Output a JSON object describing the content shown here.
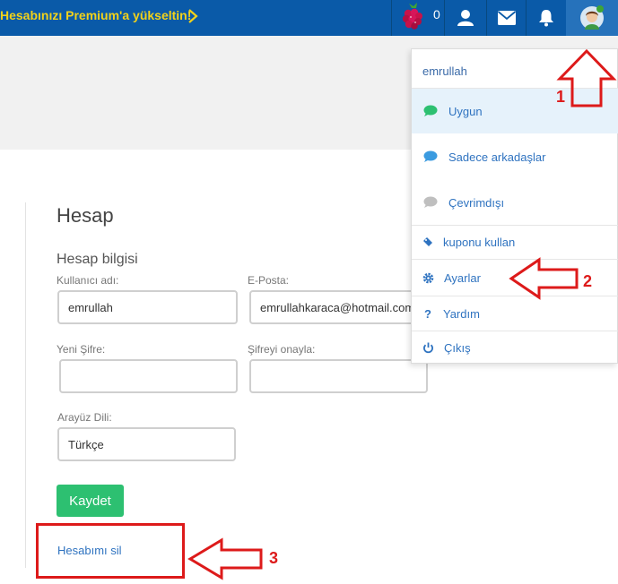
{
  "topbar": {
    "premium_label": "Hesabınızı Premium'a yükseltin!",
    "credits": "0",
    "icons": [
      "raspberry-icon",
      "user-icon",
      "mail-icon",
      "bell-icon",
      "avatar-icon"
    ],
    "background": "#0a5aa8",
    "premium_color": "#f2d21a"
  },
  "account": {
    "title": "Hesap",
    "section_title": "Hesap bilgisi",
    "username_label": "Kullanıcı adı:",
    "username_value": "emrullah",
    "email_label": "E-Posta:",
    "email_value": "emrullahkaraca@hotmail.com",
    "new_password_label": "Yeni Şifre:",
    "confirm_password_label": "Şifreyi onayla:",
    "language_label": "Arayüz Dili:",
    "language_value": "Türkçe",
    "save_label": "Kaydet",
    "delete_label": "Hesabımı sil",
    "save_color": "#2dc071",
    "link_color": "#2f73c0"
  },
  "menu": {
    "username": "emrullah",
    "status_items": [
      {
        "label": "Uygun",
        "icon": "chat-bubble-green-icon"
      },
      {
        "label": "Sadece arkadaşlar",
        "icon": "chat-bubble-blue-icon"
      },
      {
        "label": "Çevrimdışı",
        "icon": "chat-bubble-grey-icon"
      }
    ],
    "action_items": [
      {
        "label": "kuponu kullan",
        "icon": "ticket-icon"
      },
      {
        "label": "Ayarlar",
        "icon": "gear-icon"
      },
      {
        "label": "Yardım",
        "icon": "question-icon"
      },
      {
        "label": "Çıkış",
        "icon": "power-icon"
      }
    ]
  },
  "annotations": {
    "step1": "1",
    "step2": "2",
    "step3": "3",
    "color": "#dd1a1a"
  }
}
